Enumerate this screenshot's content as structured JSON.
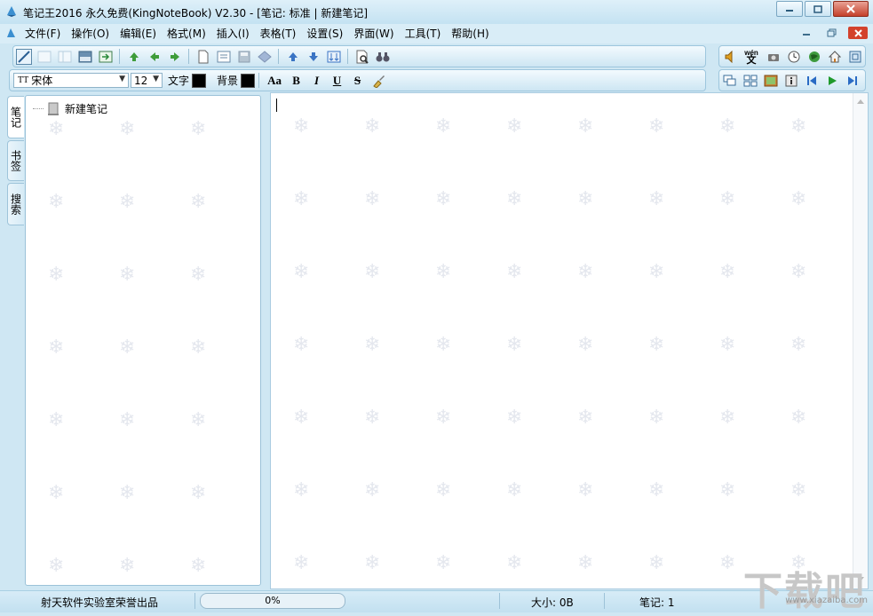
{
  "window": {
    "title": "笔记王2016 永久免费(KingNoteBook) V2.30 - [笔记: 标准 | 新建笔记]",
    "accent": "#cfe7f3",
    "close_color": "#d3422c"
  },
  "menu": [
    {
      "label": "文件(F)"
    },
    {
      "label": "操作(O)"
    },
    {
      "label": "编辑(E)"
    },
    {
      "label": "格式(M)"
    },
    {
      "label": "插入(I)"
    },
    {
      "label": "表格(T)"
    },
    {
      "label": "设置(S)"
    },
    {
      "label": "界面(W)"
    },
    {
      "label": "工具(T)"
    },
    {
      "label": "帮助(H)"
    }
  ],
  "format_toolbar": {
    "font_name": "宋体",
    "font_size": "12",
    "text_color_label": "文字",
    "bg_color_label": "背景",
    "text_color": "#000000",
    "bg_color": "#000000",
    "font_btn": "Aa",
    "bold": "B",
    "italic": "I",
    "underline": "U",
    "strike": "S"
  },
  "right_toolbar_top": {
    "translate_label": "wén"
  },
  "side_tabs": [
    {
      "label": "笔记"
    },
    {
      "label": "书签"
    },
    {
      "label": "搜索"
    }
  ],
  "tree": {
    "root_label": "新建笔记"
  },
  "status": {
    "credit": "射天软件实验室荣誉出品",
    "progress": "0%",
    "progress_value": 0,
    "size_text": "大小: 0B",
    "notes_text": "笔记: 1"
  },
  "watermark": {
    "logo_text": "下载吧",
    "url": "www.xiazaiba.com"
  }
}
